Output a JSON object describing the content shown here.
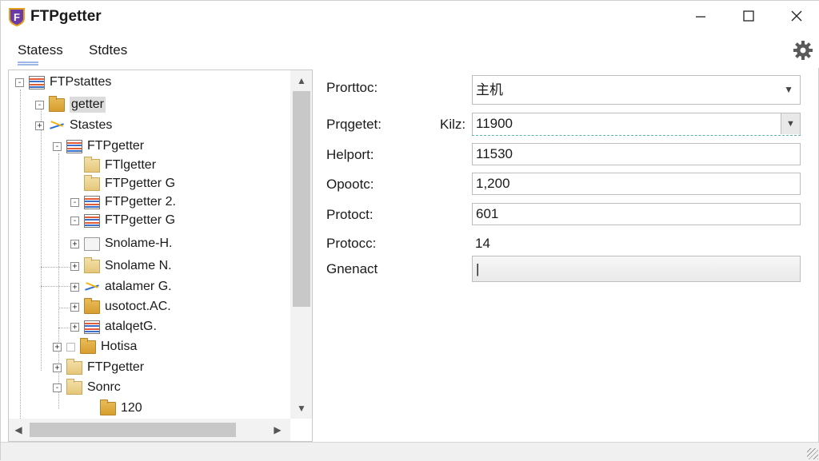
{
  "app": {
    "title": "FTPgetter",
    "icon_letter": "F"
  },
  "window_controls": {
    "minimize": "—",
    "maximize": "☐",
    "close": "✕"
  },
  "tabs": [
    {
      "label": "Statess"
    },
    {
      "label": "Stdtes"
    }
  ],
  "tree": {
    "items": [
      {
        "label": "FTPstattes",
        "icon": "list-icon",
        "expander": "-"
      },
      {
        "label": "getter",
        "icon": "folder-icon",
        "expander": "-"
      },
      {
        "label": "Stastes",
        "icon": "network-icon",
        "expander": "+"
      },
      {
        "label": "FTPgetter",
        "icon": "list-icon",
        "expander": "-"
      },
      {
        "label": "FTlgetter",
        "icon": "folder-icon",
        "expander": ""
      },
      {
        "label": "FTPgetter G",
        "icon": "folder-icon",
        "expander": ""
      },
      {
        "label": "FTPgetter 2.",
        "icon": "list-icon",
        "expander": "-"
      },
      {
        "label": "FTPgetter G",
        "icon": "list-icon",
        "expander": "-"
      },
      {
        "label": "Snolame-H.",
        "icon": "document-icon",
        "expander": "+"
      },
      {
        "label": "Snolame N.",
        "icon": "folder-icon",
        "expander": "+"
      },
      {
        "label": "atalamer G.",
        "icon": "network-icon",
        "expander": "+"
      },
      {
        "label": "usotoct.AC.",
        "icon": "folder-icon",
        "expander": "+"
      },
      {
        "label": "atalqetG.",
        "icon": "list-icon",
        "expander": "+"
      },
      {
        "label": "Hotisa",
        "icon": "folder-icon",
        "expander": "+"
      },
      {
        "label": "FTPgetter",
        "icon": "folder-icon",
        "expander": "+"
      },
      {
        "label": "Sonrc",
        "icon": "folder-icon",
        "expander": "-"
      },
      {
        "label": "120",
        "icon": "folder-icon",
        "expander": ""
      }
    ]
  },
  "properties": {
    "protocol_label": "Prorttoc:",
    "protocol_value": "主机",
    "proxyget_label": "Prqgetet:",
    "kilz_label": "Kilz:",
    "kilz_value": "11900",
    "helport_label": "Helport:",
    "helport_value": "11530",
    "opport_label": "Opootc:",
    "opport_value": "1,200",
    "protoct_label": "Protoct:",
    "protoct_value": "601",
    "protocc_label": "Protocc:",
    "protocc_value": "14",
    "genenact_label": "Gnenact",
    "genenact_value": "|"
  }
}
